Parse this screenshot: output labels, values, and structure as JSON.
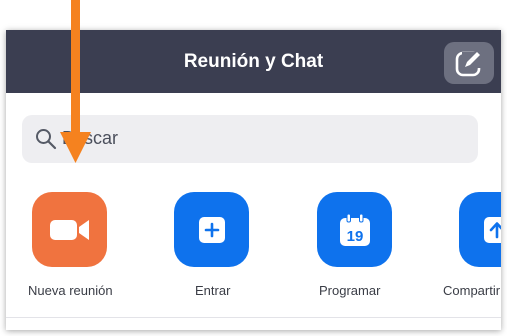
{
  "header": {
    "title": "Reunión y Chat",
    "compose_icon": "compose-icon"
  },
  "search": {
    "text": "Buscar",
    "icon": "search-icon"
  },
  "actions": [
    {
      "label": "Nueva reunión",
      "icon": "video-camera-icon",
      "color": "#f0733f"
    },
    {
      "label": "Entrar",
      "icon": "plus-icon",
      "color": "#0e72ed"
    },
    {
      "label": "Programar",
      "icon": "calendar-icon",
      "color": "#0e72ed",
      "calendar_day": "19"
    },
    {
      "label": "Compartir",
      "icon": "share-screen-icon",
      "color": "#0e72ed"
    }
  ],
  "colors": {
    "header_bg": "#3b3e51",
    "pointer_arrow": "#f5821f"
  }
}
